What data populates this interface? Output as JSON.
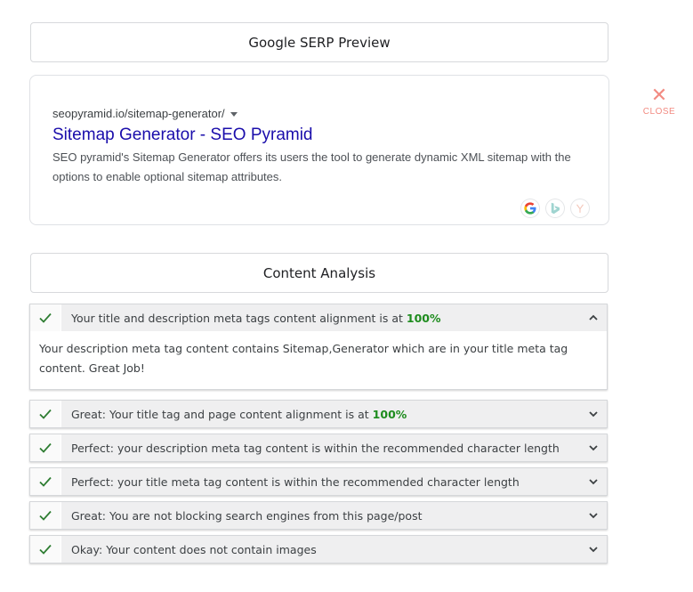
{
  "serp_panel": {
    "title": "Google SERP Preview"
  },
  "serp_preview": {
    "url": "seopyramid.io/sitemap-generator/",
    "headline": "Sitemap Generator - SEO Pyramid",
    "description": "SEO pyramid's Sitemap Generator offers its users the tool to generate dynamic XML sitemap with the options to enable optional sitemap attributes.",
    "engines": [
      {
        "name": "google",
        "icon": "google-icon"
      },
      {
        "name": "bing",
        "icon": "bing-icon"
      },
      {
        "name": "yahoo",
        "icon": "yahoo-icon"
      }
    ]
  },
  "close": {
    "label": "CLOSE",
    "color": "#f28b82"
  },
  "content_panel": {
    "title": "Content Analysis"
  },
  "analysis": [
    {
      "prefix": "Your title and description meta tags content alignment is at ",
      "percent": "100%",
      "expanded": true,
      "body": "Your description meta tag content contains Sitemap,Generator which are in your title meta tag content. Great Job!"
    },
    {
      "prefix": "Great: Your title tag and page content alignment is at ",
      "percent": "100%",
      "expanded": false
    },
    {
      "prefix": "Perfect: your description meta tag content is within the recommended character length",
      "percent": "",
      "expanded": false
    },
    {
      "prefix": "Perfect: your title meta tag content is within the recommended character length",
      "percent": "",
      "expanded": false
    },
    {
      "prefix": "Great: You are not blocking search engines from this page/post",
      "percent": "",
      "expanded": false
    },
    {
      "prefix": "Okay: Your content does not contain images",
      "percent": "",
      "expanded": false
    }
  ],
  "colors": {
    "link": "#1a0dab",
    "success": "#1e8c1e",
    "check": "#2e7d32",
    "header_bg": "#efeff0"
  }
}
